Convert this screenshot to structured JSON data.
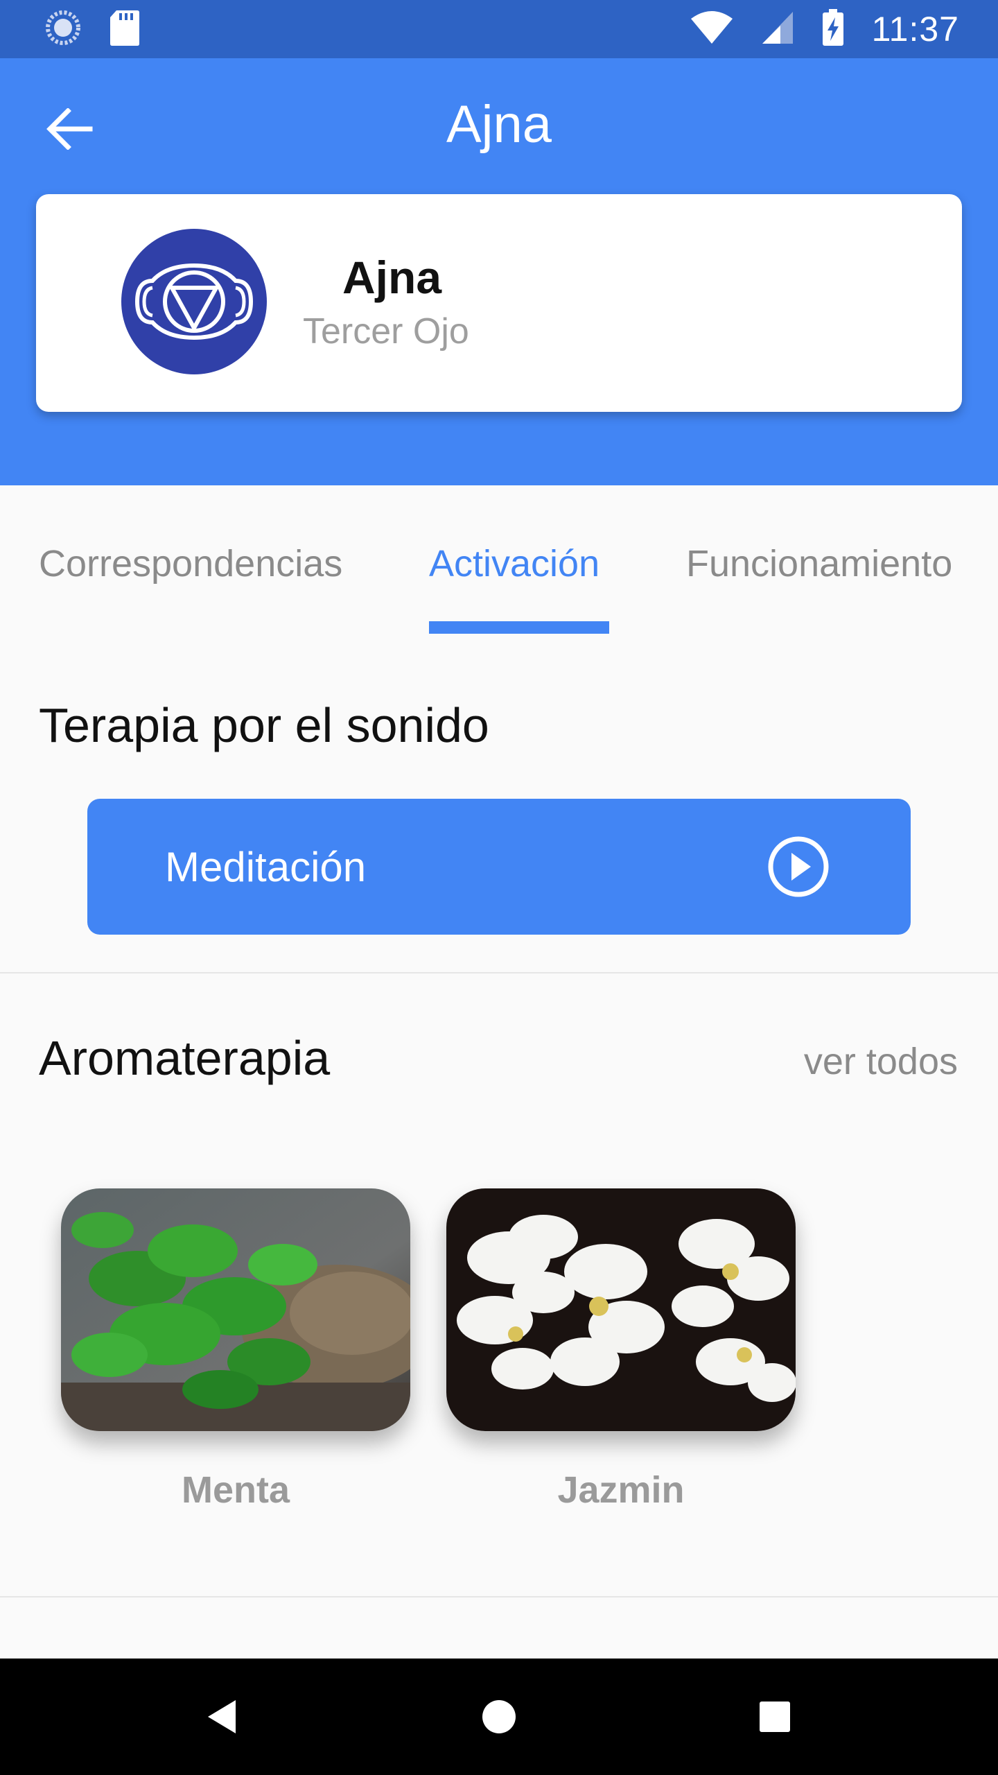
{
  "status_bar": {
    "time": "11:37",
    "icons": [
      "loading-icon",
      "sd-card-icon",
      "wifi-icon",
      "signal-icon",
      "battery-charging-icon"
    ]
  },
  "app_bar": {
    "title": "Ajna",
    "back_icon": "arrow-left-icon"
  },
  "chakra": {
    "name": "Ajna",
    "subtitle": "Tercer Ojo",
    "icon": "third-eye-chakra-icon"
  },
  "tabs": [
    {
      "label": "Correspondencias",
      "active": false
    },
    {
      "label": "Activación",
      "active": true
    },
    {
      "label": "Funcionamiento",
      "active": false
    }
  ],
  "sound_therapy": {
    "title": "Terapia por el sonido",
    "button_label": "Meditación",
    "button_icon": "play-circle-icon"
  },
  "aromatherapy": {
    "title": "Aromaterapia",
    "see_all": "ver todos",
    "items": [
      {
        "label": "Menta",
        "image": "mint-leaves-photo"
      },
      {
        "label": "Jazmin",
        "image": "jasmine-flowers-photo"
      }
    ]
  },
  "colors": {
    "primary": "#4285f4",
    "status_bar": "#2e63c4",
    "chakra_avatar": "#3040a8"
  }
}
